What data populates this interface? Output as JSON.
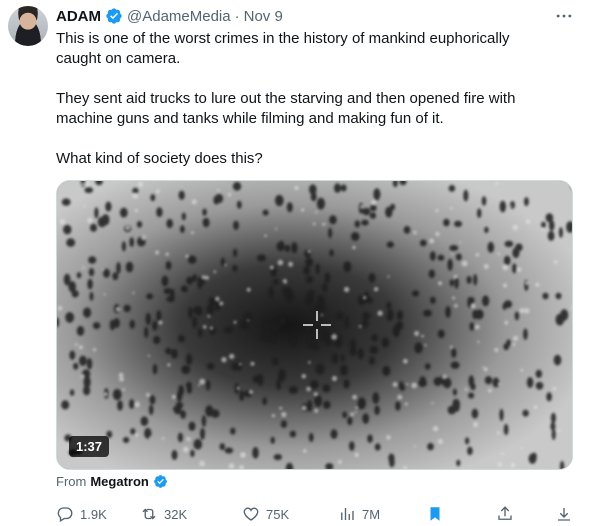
{
  "post": {
    "author_name": "ADAM",
    "author_handle": "@AdameMedia",
    "separator": "·",
    "date": "Nov 9",
    "paragraphs": [
      "This is one of the worst crimes in the history of mankind euphorically caught on camera.",
      "They sent aid trucks to lure out the starving and then opened fire with machine guns and tanks while filming and making fun of it.",
      "What kind of society does this?"
    ],
    "more_icon": "more-dots-icon",
    "verified_color": "#1d9bf0"
  },
  "media": {
    "duration": "1:37",
    "from_label": "From",
    "from_source": "Megatron"
  },
  "actions": {
    "replies": "1.9K",
    "reposts": "32K",
    "likes": "75K",
    "views": "7M",
    "bookmark_color": "#1d9bf0",
    "icons": [
      "reply-icon",
      "repost-icon",
      "like-icon",
      "views-icon",
      "bookmark-icon",
      "share-icon"
    ]
  }
}
